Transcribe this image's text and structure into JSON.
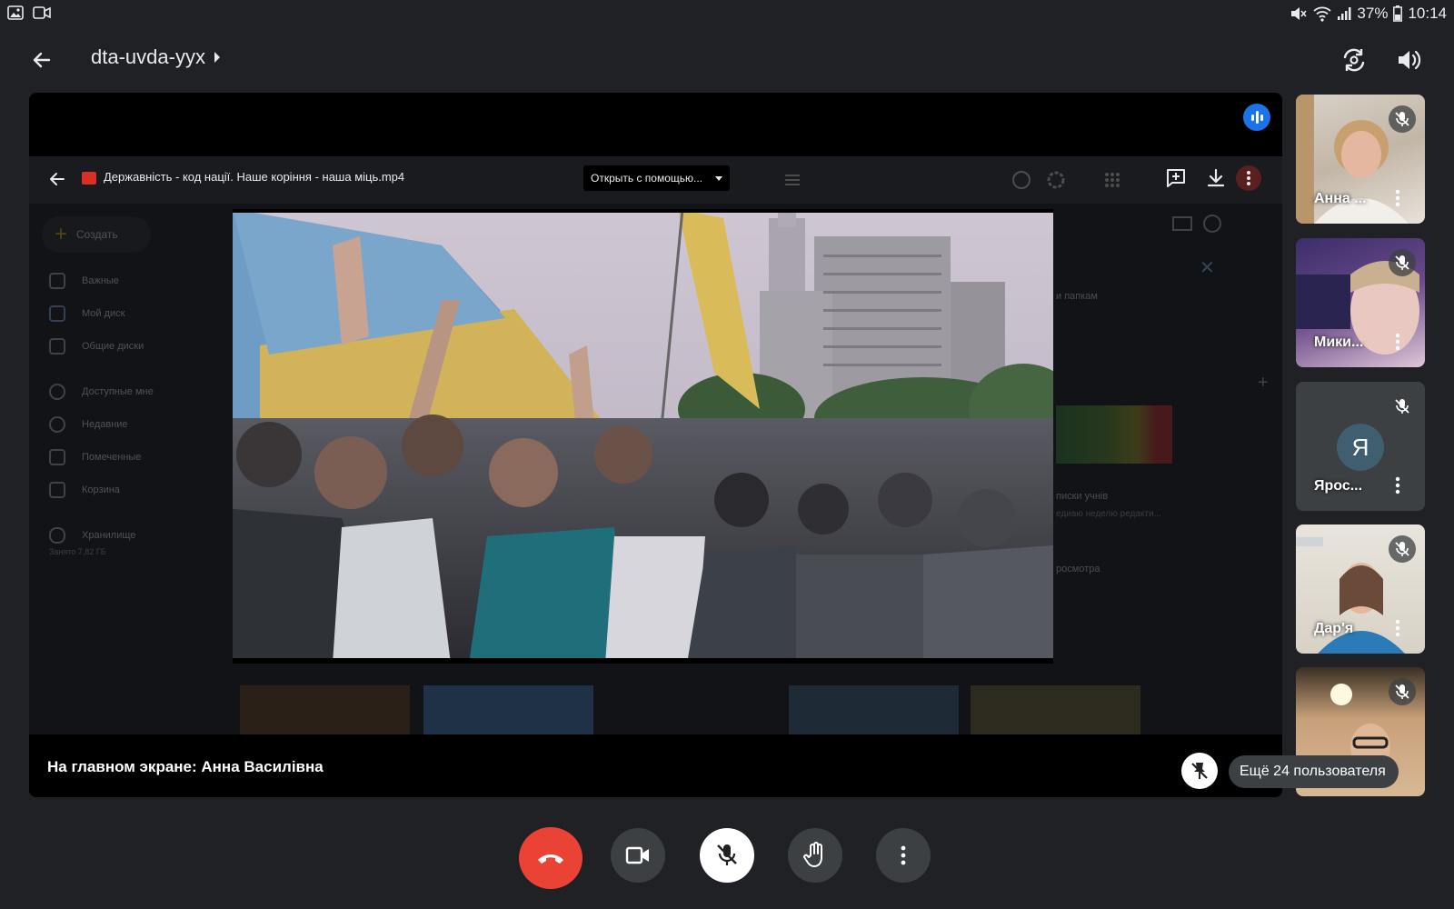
{
  "status_bar": {
    "battery": "37%",
    "time": "10:14"
  },
  "header": {
    "meeting_code": "dta-uvda-yyx"
  },
  "shared_screen": {
    "file_name": "Державність - код нації. Наше коріння - наша міць.mp4",
    "open_with_label": "Открыть с помощью...",
    "drive_sidebar": {
      "create_label": "Создать",
      "items": [
        "Важные",
        "Мой диск",
        "Общие диски",
        "Доступные мне",
        "Недавние",
        "Помеченные",
        "Корзина",
        "Хранилище"
      ],
      "storage_note": "Занято 7,82 ГБ"
    },
    "drive_right": {
      "text1": "и папкам",
      "text2": "писки учнів",
      "text3": "едиаю неделю редакти...",
      "text4": "росмотра"
    }
  },
  "stage_footer": {
    "main_screen_label": "На главном экране: Анна Василівна"
  },
  "participants": [
    {
      "name": "Анна ...",
      "avatar_letter": ""
    },
    {
      "name": "Мики...",
      "avatar_letter": ""
    },
    {
      "name": "Ярос...",
      "avatar_letter": "Я"
    },
    {
      "name": "Дар'я",
      "avatar_letter": ""
    },
    {
      "name": "",
      "avatar_letter": ""
    }
  ],
  "more_participants_label": "Ещё 24 пользователя",
  "colors": {
    "background": "#202124",
    "end_call": "#ea4335",
    "control_bg": "#3c4043",
    "accent_blue": "#1a73e8"
  }
}
